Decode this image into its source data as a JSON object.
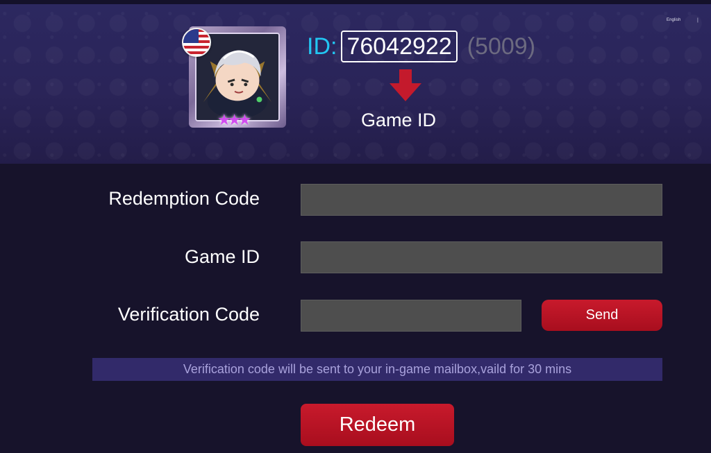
{
  "header": {
    "language": "English",
    "language_separator": "|",
    "id_label": "ID:",
    "player_id": "76042922",
    "zone_id": "(5009)",
    "caption": "Game ID"
  },
  "avatar": {
    "flag_icon": "us-flag-icon",
    "star_count": 3,
    "stars_text": "★★★"
  },
  "form": {
    "redemption_code": {
      "label": "Redemption Code",
      "value": "",
      "placeholder": ""
    },
    "game_id": {
      "label": "Game ID",
      "value": "",
      "placeholder": ""
    },
    "verification_code": {
      "label": "Verification Code",
      "value": "",
      "placeholder": ""
    },
    "send_label": "Send",
    "notice": "Verification code will be sent to your in-game mailbox,vaild for 30 mins",
    "redeem_label": "Redeem"
  },
  "colors": {
    "accent_red": "#c41a2c",
    "id_cyan": "#22c6f2",
    "notice_bg": "#322a6a",
    "page_bg": "#17132b"
  }
}
